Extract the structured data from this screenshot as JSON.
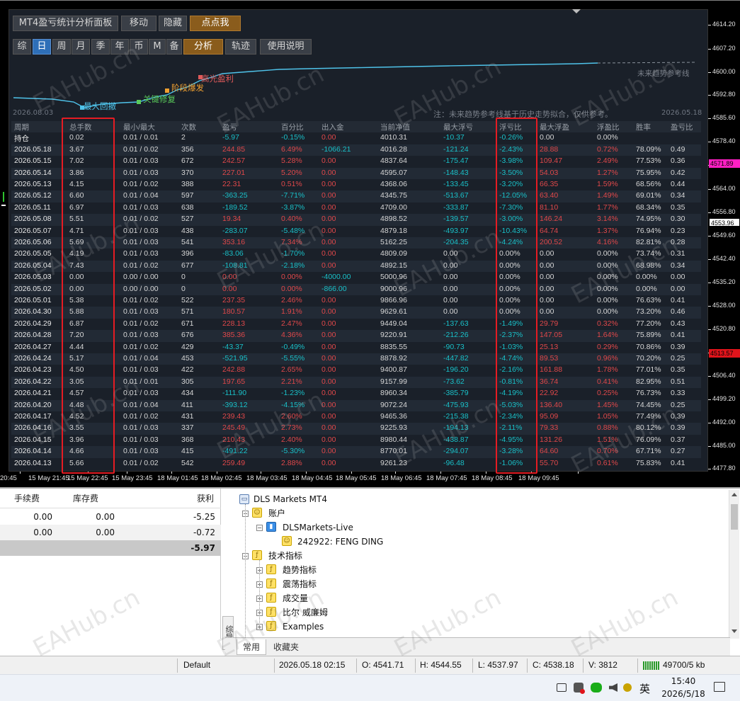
{
  "toolbar1": [
    "MT4盈亏统计分析面板",
    "移动",
    "隐藏",
    "点点我"
  ],
  "toolbar2": [
    "综",
    "日",
    "周",
    "月",
    "季",
    "年",
    "币",
    "M",
    "备",
    "分析",
    "轨迹",
    "使用说明"
  ],
  "mini_chart": {
    "labels": [
      "最大回撤",
      "关键修复",
      "阶段爆发",
      "高光盈利",
      "未来趋势参考线"
    ],
    "date_start": "2026.08.03",
    "date_end": "2026.05.18",
    "note": "注：未来趋势参考线基于历史走势拟合，仅供参考。"
  },
  "table": {
    "headers": [
      "周期",
      "总手数",
      "最小/最大",
      "次数",
      "盈亏",
      "百分比",
      "出入金",
      "当前净值",
      "最大浮亏",
      "浮亏比",
      "最大浮盈",
      "浮盈比",
      "胜率",
      "盈亏比"
    ],
    "rows": [
      [
        "持仓",
        "0.02",
        "0.01 / 0.01",
        "2",
        "-5.97",
        "-0.15%",
        "0.00",
        "4010.31",
        "-10.37",
        "-0.26%",
        "0.00",
        "0.00%",
        "",
        ""
      ],
      [
        "2026.05.18",
        "3.67",
        "0.01 / 0.02",
        "356",
        "244.85",
        "6.49%",
        "-1066.21",
        "4016.28",
        "-121.24",
        "-2.43%",
        "28.88",
        "0.72%",
        "78.09%",
        "0.49"
      ],
      [
        "2026.05.15",
        "7.02",
        "0.01 / 0.03",
        "672",
        "242.57",
        "5.28%",
        "0.00",
        "4837.64",
        "-175.47",
        "-3.98%",
        "109.47",
        "2.49%",
        "77.53%",
        "0.36"
      ],
      [
        "2026.05.14",
        "3.86",
        "0.01 / 0.03",
        "370",
        "227.01",
        "5.20%",
        "0.00",
        "4595.07",
        "-148.43",
        "-3.50%",
        "54.03",
        "1.27%",
        "75.95%",
        "0.42"
      ],
      [
        "2026.05.13",
        "4.15",
        "0.01 / 0.02",
        "388",
        "22.31",
        "0.51%",
        "0.00",
        "4368.06",
        "-133.45",
        "-3.20%",
        "66.35",
        "1.59%",
        "68.56%",
        "0.44"
      ],
      [
        "2026.05.12",
        "6.60",
        "0.01 / 0.04",
        "597",
        "-363.25",
        "-7.71%",
        "0.00",
        "4345.75",
        "-513.67",
        "-12.05%",
        "63.40",
        "1.49%",
        "69.01%",
        "0.34"
      ],
      [
        "2026.05.11",
        "6.97",
        "0.01 / 0.03",
        "638",
        "-189.52",
        "-3.87%",
        "0.00",
        "4709.00",
        "-333.87",
        "-7.30%",
        "81.10",
        "1.77%",
        "68.34%",
        "0.35"
      ],
      [
        "2026.05.08",
        "5.51",
        "0.01 / 0.02",
        "527",
        "19.34",
        "0.40%",
        "0.00",
        "4898.52",
        "-139.57",
        "-3.00%",
        "146.24",
        "3.14%",
        "74.95%",
        "0.30"
      ],
      [
        "2026.05.07",
        "4.71",
        "0.01 / 0.03",
        "438",
        "-283.07",
        "-5.48%",
        "0.00",
        "4879.18",
        "-493.97",
        "-10.43%",
        "64.74",
        "1.37%",
        "76.94%",
        "0.23"
      ],
      [
        "2026.05.06",
        "5.69",
        "0.01 / 0.03",
        "541",
        "353.16",
        "7.34%",
        "0.00",
        "5162.25",
        "-204.35",
        "-4.24%",
        "200.52",
        "4.16%",
        "82.81%",
        "0.28"
      ],
      [
        "2026.05.05",
        "4.19",
        "0.01 / 0.03",
        "396",
        "-83.06",
        "-1.70%",
        "0.00",
        "4809.09",
        "0.00",
        "0.00%",
        "0.00",
        "0.00%",
        "73.74%",
        "0.31"
      ],
      [
        "2026.05.04",
        "7.43",
        "0.01 / 0.02",
        "677",
        "-108.81",
        "-2.18%",
        "0.00",
        "4892.15",
        "0.00",
        "0.00%",
        "0.00",
        "0.00%",
        "68.98%",
        "0.34"
      ],
      [
        "2026.05.03",
        "0.00",
        "0.00 / 0.00",
        "0",
        "0.00",
        "0.00%",
        "-4000.00",
        "5000.96",
        "0.00",
        "0.00%",
        "0.00",
        "0.00%",
        "0.00%",
        "0.00"
      ],
      [
        "2026.05.02",
        "0.00",
        "0.00 / 0.00",
        "0",
        "0.00",
        "0.00%",
        "-866.00",
        "9000.96",
        "0.00",
        "0.00%",
        "0.00",
        "0.00%",
        "0.00%",
        "0.00"
      ],
      [
        "2026.05.01",
        "5.38",
        "0.01 / 0.02",
        "522",
        "237.35",
        "2.46%",
        "0.00",
        "9866.96",
        "0.00",
        "0.00%",
        "0.00",
        "0.00%",
        "76.63%",
        "0.41"
      ],
      [
        "2026.04.30",
        "5.88",
        "0.01 / 0.03",
        "571",
        "180.57",
        "1.91%",
        "0.00",
        "9629.61",
        "0.00",
        "0.00%",
        "0.00",
        "0.00%",
        "73.20%",
        "0.46"
      ],
      [
        "2026.04.29",
        "6.87",
        "0.01 / 0.02",
        "671",
        "228.13",
        "2.47%",
        "0.00",
        "9449.04",
        "-137.63",
        "-1.49%",
        "29.79",
        "0.32%",
        "77.20%",
        "0.43"
      ],
      [
        "2026.04.28",
        "7.20",
        "0.01 / 0.03",
        "676",
        "385.36",
        "4.36%",
        "0.00",
        "9220.91",
        "-212.26",
        "-2.37%",
        "147.05",
        "1.64%",
        "75.89%",
        "0.41"
      ],
      [
        "2026.04.27",
        "4.44",
        "0.01 / 0.02",
        "429",
        "-43.37",
        "-0.49%",
        "0.00",
        "8835.55",
        "-90.73",
        "-1.03%",
        "25.13",
        "0.29%",
        "70.86%",
        "0.39"
      ],
      [
        "2026.04.24",
        "5.17",
        "0.01 / 0.04",
        "453",
        "-521.95",
        "-5.55%",
        "0.00",
        "8878.92",
        "-447.82",
        "-4.74%",
        "89.53",
        "0.96%",
        "70.20%",
        "0.25"
      ],
      [
        "2026.04.23",
        "4.50",
        "0.01 / 0.03",
        "422",
        "242.88",
        "2.65%",
        "0.00",
        "9400.87",
        "-196.20",
        "-2.16%",
        "161.88",
        "1.78%",
        "77.01%",
        "0.35"
      ],
      [
        "2026.04.22",
        "3.05",
        "0.01 / 0.01",
        "305",
        "197.65",
        "2.21%",
        "0.00",
        "9157.99",
        "-73.62",
        "-0.81%",
        "36.74",
        "0.41%",
        "82.95%",
        "0.51"
      ],
      [
        "2026.04.21",
        "4.57",
        "0.01 / 0.03",
        "434",
        "-111.90",
        "-1.23%",
        "0.00",
        "8960.34",
        "-385.79",
        "-4.19%",
        "22.92",
        "0.25%",
        "76.73%",
        "0.33"
      ],
      [
        "2026.04.20",
        "4.48",
        "0.01 / 0.04",
        "411",
        "-393.12",
        "-4.15%",
        "0.00",
        "9072.24",
        "-475.93",
        "-5.03%",
        "136.40",
        "1.45%",
        "74.45%",
        "0.25"
      ],
      [
        "2026.04.17",
        "4.52",
        "0.01 / 0.02",
        "431",
        "239.43",
        "2.60%",
        "0.00",
        "9465.36",
        "-215.38",
        "-2.34%",
        "95.09",
        "1.05%",
        "77.49%",
        "0.39"
      ],
      [
        "2026.04.16",
        "3.55",
        "0.01 / 0.03",
        "337",
        "245.49",
        "2.73%",
        "0.00",
        "9225.93",
        "-194.13",
        "-2.11%",
        "79.33",
        "0.88%",
        "80.12%",
        "0.39"
      ],
      [
        "2026.04.15",
        "3.96",
        "0.01 / 0.03",
        "368",
        "210.43",
        "2.40%",
        "0.00",
        "8980.44",
        "-438.87",
        "-4.95%",
        "131.26",
        "1.51%",
        "76.09%",
        "0.37"
      ],
      [
        "2026.04.14",
        "4.66",
        "0.01 / 0.03",
        "415",
        "-491.22",
        "-5.30%",
        "0.00",
        "8770.01",
        "-294.07",
        "-3.28%",
        "64.60",
        "0.70%",
        "67.71%",
        "0.27"
      ],
      [
        "2026.04.13",
        "5.66",
        "0.01 / 0.02",
        "542",
        "259.49",
        "2.88%",
        "0.00",
        "9261.23",
        "-96.48",
        "-1.06%",
        "55.70",
        "0.61%",
        "75.83%",
        "0.41"
      ]
    ]
  },
  "price_scale": [
    "4614.20",
    "4607.20",
    "4600.00",
    "4592.80",
    "4585.60",
    "4578.40",
    "4571.20",
    "4564.00",
    "4556.80",
    "4549.60",
    "4542.40",
    "4535.20",
    "4528.00",
    "4520.80",
    "4513.60",
    "4506.40",
    "4499.20",
    "4492.00",
    "4485.00",
    "4477.80"
  ],
  "price_tags": {
    "pink": "4571.89",
    "white": "4553.96",
    "red": "4513.57"
  },
  "time_axis": [
    "20:45",
    "15 May 21:45",
    "15 May 22:45",
    "15 May 23:45",
    "18 May 01:45",
    "18 May 02:45",
    "18 May 03:45",
    "18 May 04:45",
    "18 May 05:45",
    "18 May 06:45",
    "18 May 07:45",
    "18 May 08:45",
    "18 May 09:45"
  ],
  "watermark": "EAHub.cn",
  "trade_panel": {
    "headers": [
      "手续费",
      "库存费",
      "获利"
    ],
    "rows": [
      [
        "0.00",
        "0.00",
        "-5.25"
      ],
      [
        "0.00",
        "0.00",
        "-0.72"
      ]
    ],
    "total": "-5.97"
  },
  "navigator": {
    "root": "DLS Markets MT4",
    "items": [
      "账户",
      "DLSMarkets-Live",
      "242922: FENG DING",
      "技术指标",
      "趋势指标",
      "震荡指标",
      "成交量",
      "比尔 威廉姆",
      "Examples"
    ],
    "side_tab": "综导",
    "tabs": [
      "常用",
      "收藏夹"
    ]
  },
  "status": {
    "profile": "Default",
    "time": "2026.05.18 02:15",
    "open": "O: 4541.71",
    "high": "H: 4544.55",
    "low": "L: 4537.97",
    "close": "C: 4538.18",
    "volume": "V: 3812",
    "traffic": "49700/5 kb"
  },
  "taskbar": {
    "ime": "英",
    "clock_time": "15:40",
    "clock_date": "2026/5/18"
  }
}
